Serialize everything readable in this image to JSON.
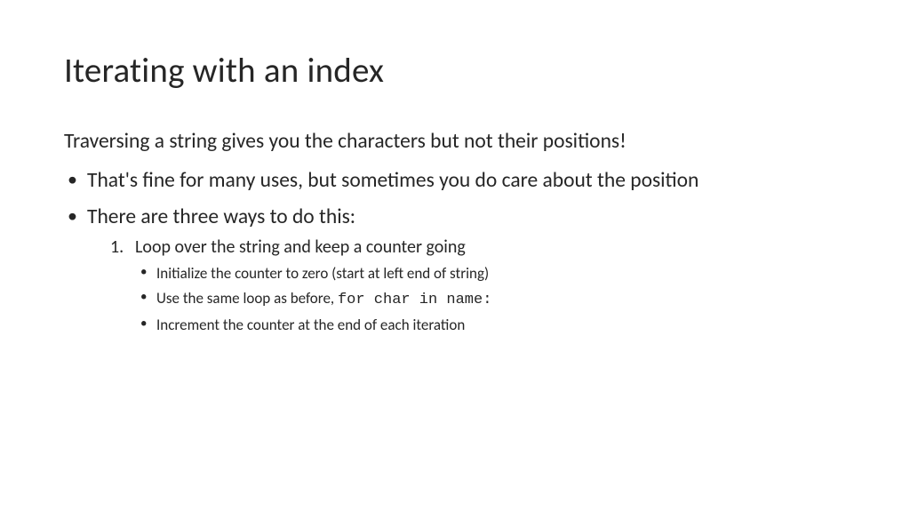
{
  "title": "Iterating with an index",
  "intro": "Traversing a string gives you the characters but not their positions!",
  "bullets": [
    {
      "text": "That's fine for many uses, but sometimes you do care about the position"
    },
    {
      "text": "There are three ways to do this:",
      "numbered": [
        {
          "text": "Loop over the string and keep a counter going",
          "sub": [
            {
              "text": "Initialize the counter to zero (start at left end of string)"
            },
            {
              "prefix": "Use the same loop as before, ",
              "code": "for char in name",
              "suffix": ":"
            },
            {
              "text": "Increment the counter at the end of each iteration"
            }
          ]
        }
      ]
    }
  ]
}
